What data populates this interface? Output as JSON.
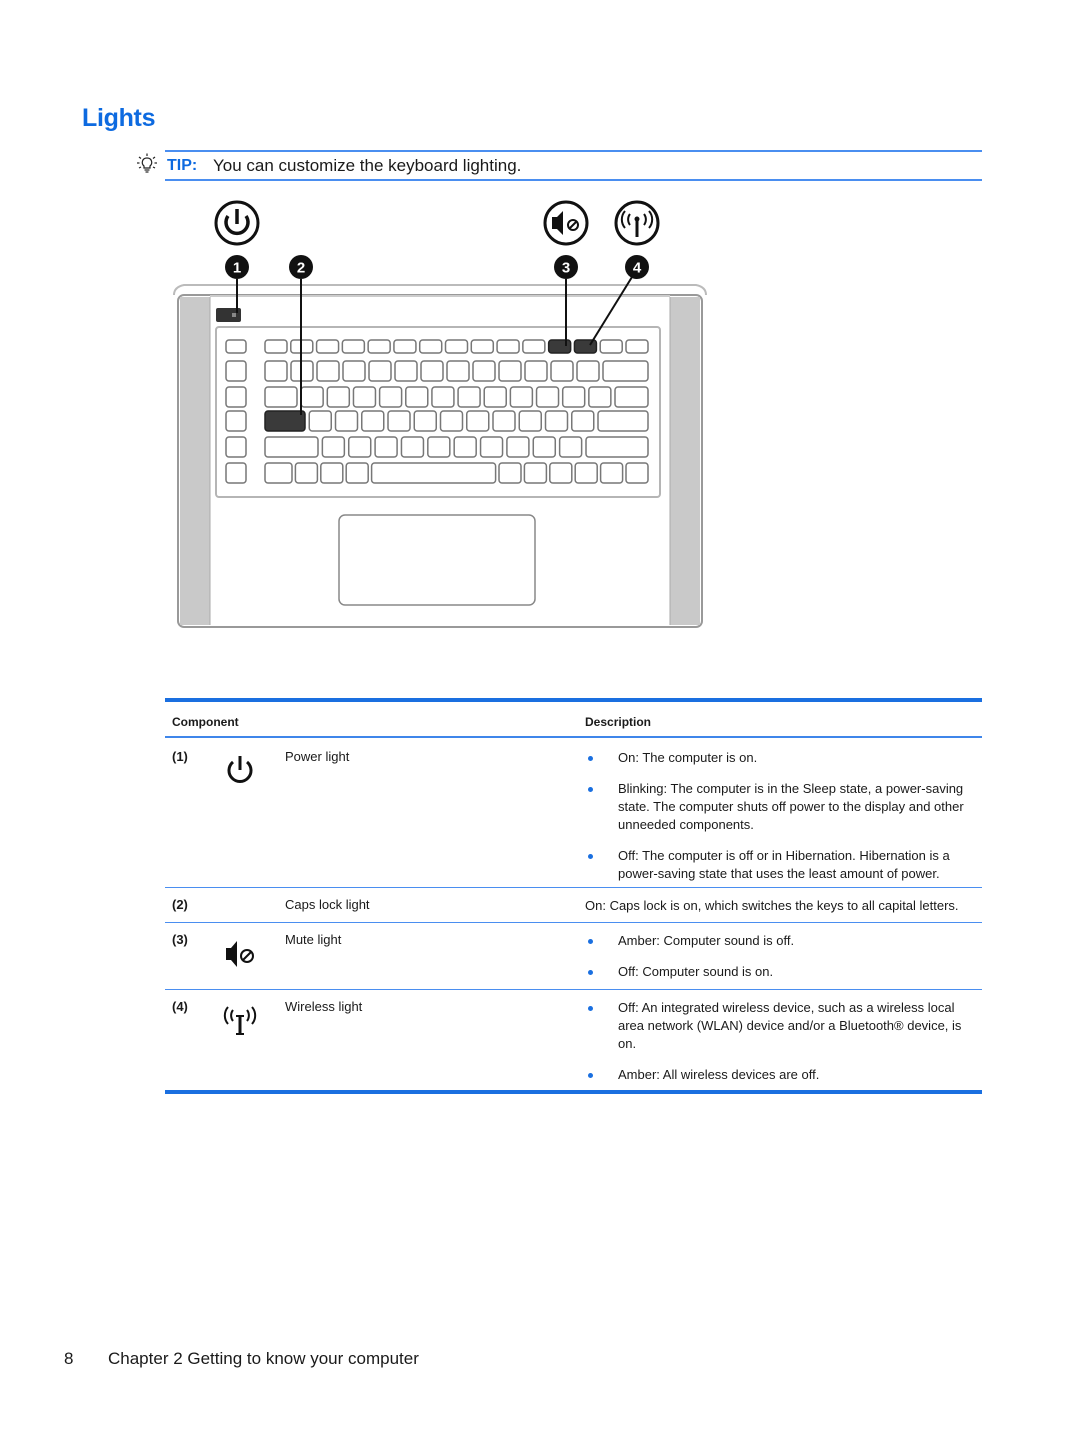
{
  "page": {
    "heading": "Lights",
    "tip": {
      "icon": "lightbulb-icon",
      "label": "TIP:",
      "text": "You can customize the keyboard lighting."
    },
    "diagram": {
      "description": "Laptop keyboard top view with callouts",
      "callouts": [
        {
          "number": "1",
          "icon": "power-icon"
        },
        {
          "number": "2",
          "icon": null
        },
        {
          "number": "3",
          "icon": "mute-icon"
        },
        {
          "number": "4",
          "icon": "wireless-icon"
        }
      ]
    },
    "table": {
      "headers": {
        "component": "Component",
        "description": "Description"
      },
      "rows": [
        {
          "number": "(1)",
          "icon": "power-icon",
          "name": "Power light",
          "bullets": [
            "On: The computer is on.",
            "Blinking: The computer is in the Sleep state, a power-saving state. The computer shuts off power to the display and other unneeded components.",
            "Off: The computer is off or in Hibernation. Hibernation is a power-saving state that uses the least amount of power."
          ]
        },
        {
          "number": "(2)",
          "icon": null,
          "name": "Caps lock light",
          "text": "On: Caps lock is on, which switches the keys to all capital letters."
        },
        {
          "number": "(3)",
          "icon": "mute-icon",
          "name": "Mute light",
          "bullets": [
            "Amber: Computer sound is off.",
            "Off: Computer sound is on."
          ]
        },
        {
          "number": "(4)",
          "icon": "wireless-icon",
          "name": "Wireless light",
          "bullets": [
            "Off: An integrated wireless device, such as a wireless local area network (WLAN) device and/or a Bluetooth® device, is on.",
            "Amber: All wireless devices are off."
          ]
        }
      ]
    },
    "footer": {
      "page_number": "8",
      "chapter": "Chapter 2  Getting to know your computer"
    }
  }
}
